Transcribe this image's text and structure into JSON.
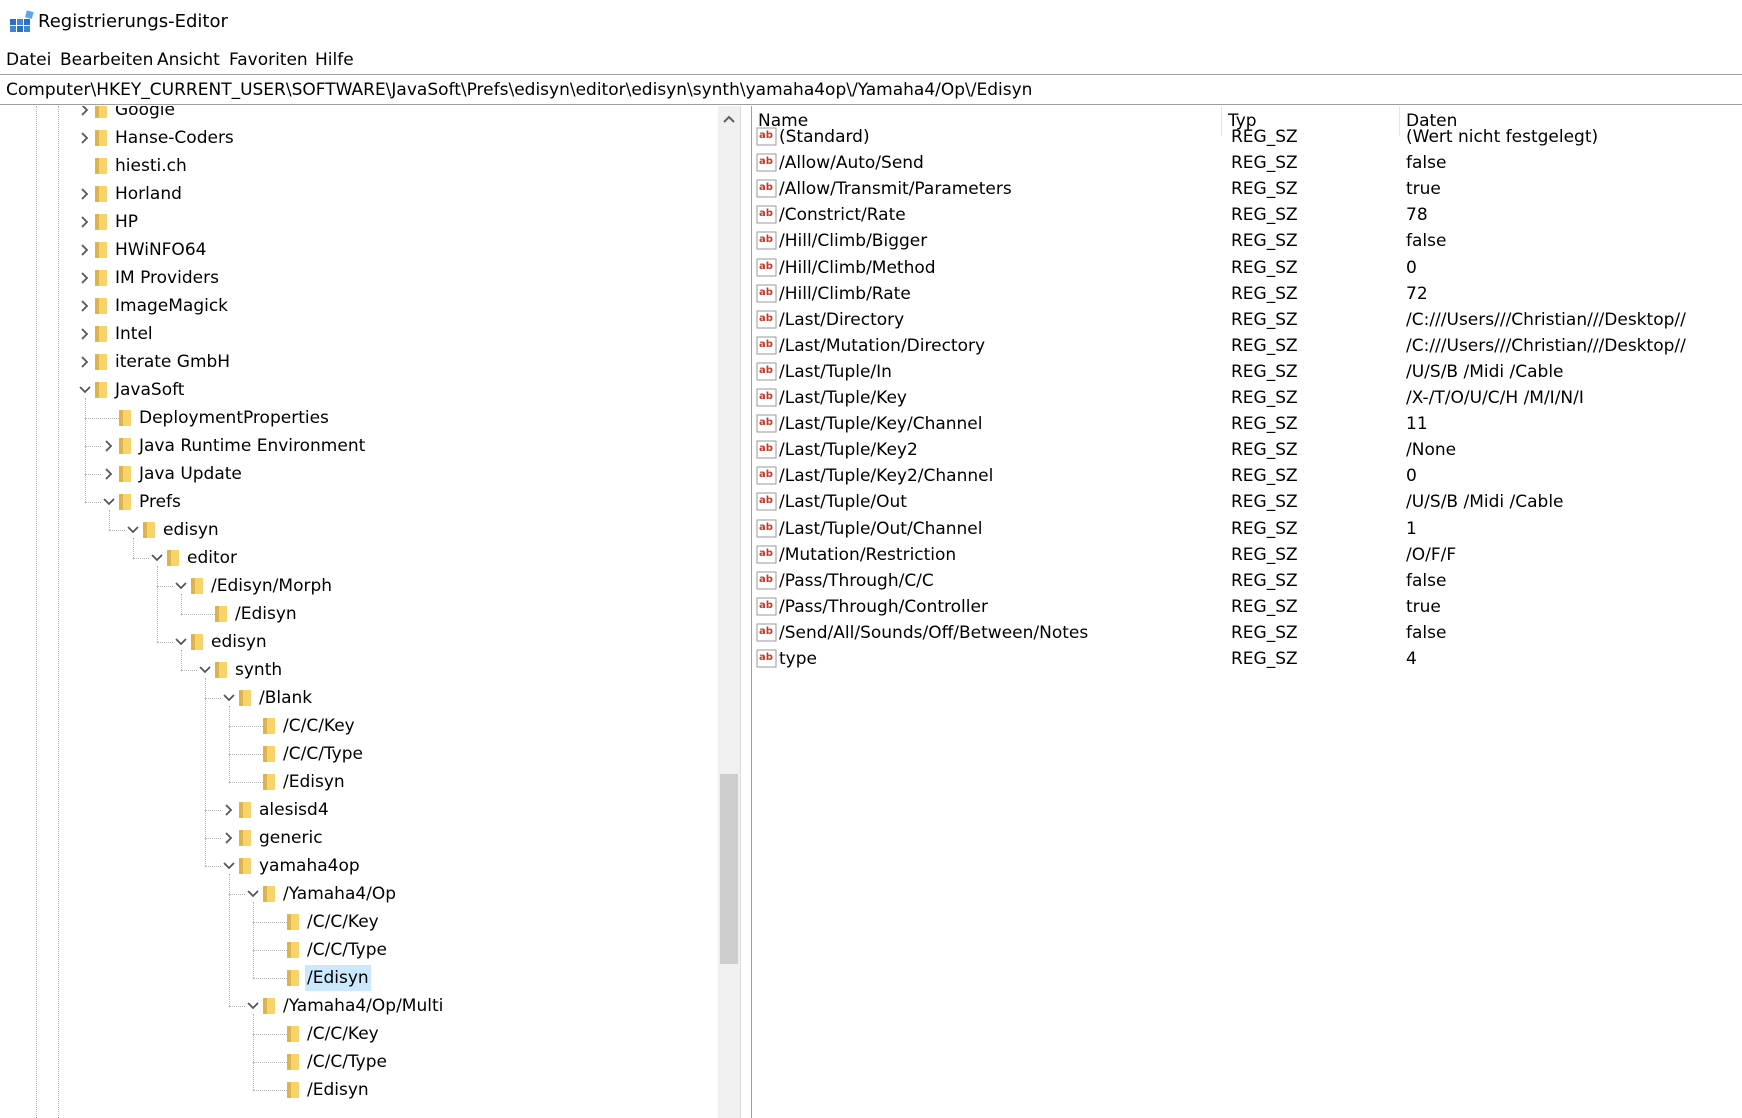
{
  "window": {
    "title": "Registrierungs-Editor",
    "icon": "registry-editor-icon"
  },
  "menu": [
    "Datei",
    "Bearbeiten",
    "Ansicht",
    "Favoriten",
    "Hilfe"
  ],
  "address": "Computer\\HKEY_CURRENT_USER\\SOFTWARE\\JavaSoft\\Prefs\\edisyn\\editor\\edisyn\\synth\\yamaha4op\\/Yamaha4/Op\\/Edisyn",
  "tree": [
    {
      "label": "Google",
      "level": 0,
      "state": "collapsed"
    },
    {
      "label": "Hanse-Coders",
      "level": 0,
      "state": "collapsed"
    },
    {
      "label": "hiesti.ch",
      "level": 0,
      "state": "leaf"
    },
    {
      "label": "Horland",
      "level": 0,
      "state": "collapsed"
    },
    {
      "label": "HP",
      "level": 0,
      "state": "collapsed"
    },
    {
      "label": "HWiNFO64",
      "level": 0,
      "state": "collapsed"
    },
    {
      "label": "IM Providers",
      "level": 0,
      "state": "collapsed"
    },
    {
      "label": "ImageMagick",
      "level": 0,
      "state": "collapsed"
    },
    {
      "label": "Intel",
      "level": 0,
      "state": "collapsed"
    },
    {
      "label": "iterate GmbH",
      "level": 0,
      "state": "collapsed"
    },
    {
      "label": "JavaSoft",
      "level": 0,
      "state": "expanded"
    },
    {
      "label": "DeploymentProperties",
      "level": 1,
      "state": "leaf"
    },
    {
      "label": "Java Runtime Environment",
      "level": 1,
      "state": "collapsed"
    },
    {
      "label": "Java Update",
      "level": 1,
      "state": "collapsed"
    },
    {
      "label": "Prefs",
      "level": 1,
      "state": "expanded"
    },
    {
      "label": "edisyn",
      "level": 2,
      "state": "expanded"
    },
    {
      "label": "editor",
      "level": 3,
      "state": "expanded"
    },
    {
      "label": "/Edisyn/Morph",
      "level": 4,
      "state": "expanded"
    },
    {
      "label": "/Edisyn",
      "level": 5,
      "state": "leaf"
    },
    {
      "label": "edisyn",
      "level": 4,
      "state": "expanded"
    },
    {
      "label": "synth",
      "level": 5,
      "state": "expanded"
    },
    {
      "label": "/Blank",
      "level": 6,
      "state": "expanded"
    },
    {
      "label": "/C/C/Key",
      "level": 7,
      "state": "leaf"
    },
    {
      "label": "/C/C/Type",
      "level": 7,
      "state": "leaf"
    },
    {
      "label": "/Edisyn",
      "level": 7,
      "state": "leaf"
    },
    {
      "label": "alesisd4",
      "level": 6,
      "state": "collapsed"
    },
    {
      "label": "generic",
      "level": 6,
      "state": "collapsed"
    },
    {
      "label": "yamaha4op",
      "level": 6,
      "state": "expanded"
    },
    {
      "label": "/Yamaha4/Op",
      "level": 7,
      "state": "expanded"
    },
    {
      "label": "/C/C/Key",
      "level": 8,
      "state": "leaf"
    },
    {
      "label": "/C/C/Type",
      "level": 8,
      "state": "leaf"
    },
    {
      "label": "/Edisyn",
      "level": 8,
      "state": "leaf",
      "selected": true
    },
    {
      "label": "/Yamaha4/Op/Multi",
      "level": 7,
      "state": "expanded"
    },
    {
      "label": "/C/C/Key",
      "level": 8,
      "state": "leaf"
    },
    {
      "label": "/C/C/Type",
      "level": 8,
      "state": "leaf"
    },
    {
      "label": "/Edisyn",
      "level": 8,
      "state": "leaf"
    }
  ],
  "columns": {
    "name": "Name",
    "type": "Typ",
    "data": "Daten"
  },
  "values": [
    {
      "name": "(Standard)",
      "type": "REG_SZ",
      "data": "(Wert nicht festgelegt)"
    },
    {
      "name": "/Allow/Auto/Send",
      "type": "REG_SZ",
      "data": "false"
    },
    {
      "name": "/Allow/Transmit/Parameters",
      "type": "REG_SZ",
      "data": "true"
    },
    {
      "name": "/Constrict/Rate",
      "type": "REG_SZ",
      "data": "78"
    },
    {
      "name": "/Hill/Climb/Bigger",
      "type": "REG_SZ",
      "data": "false"
    },
    {
      "name": "/Hill/Climb/Method",
      "type": "REG_SZ",
      "data": "0"
    },
    {
      "name": "/Hill/Climb/Rate",
      "type": "REG_SZ",
      "data": "72"
    },
    {
      "name": "/Last/Directory",
      "type": "REG_SZ",
      "data": "/C:///Users///Christian///Desktop//"
    },
    {
      "name": "/Last/Mutation/Directory",
      "type": "REG_SZ",
      "data": "/C:///Users///Christian///Desktop//"
    },
    {
      "name": "/Last/Tuple/In",
      "type": "REG_SZ",
      "data": "/U/S/B /Midi /Cable"
    },
    {
      "name": "/Last/Tuple/Key",
      "type": "REG_SZ",
      "data": "/X-/T/O/U/C/H /M/I/N/I"
    },
    {
      "name": "/Last/Tuple/Key/Channel",
      "type": "REG_SZ",
      "data": "11"
    },
    {
      "name": "/Last/Tuple/Key2",
      "type": "REG_SZ",
      "data": "/None"
    },
    {
      "name": "/Last/Tuple/Key2/Channel",
      "type": "REG_SZ",
      "data": "0"
    },
    {
      "name": "/Last/Tuple/Out",
      "type": "REG_SZ",
      "data": "/U/S/B /Midi /Cable"
    },
    {
      "name": "/Last/Tuple/Out/Channel",
      "type": "REG_SZ",
      "data": "1"
    },
    {
      "name": "/Mutation/Restriction",
      "type": "REG_SZ",
      "data": "/O/F/F"
    },
    {
      "name": "/Pass/Through/C/C",
      "type": "REG_SZ",
      "data": "false"
    },
    {
      "name": "/Pass/Through/Controller",
      "type": "REG_SZ",
      "data": "true"
    },
    {
      "name": "/Send/All/Sounds/Off/Between/Notes",
      "type": "REG_SZ",
      "data": "false"
    },
    {
      "name": "type",
      "type": "REG_SZ",
      "data": "4"
    }
  ],
  "colors": {
    "folder": "#f6d36b",
    "folder_dark": "#e0b34a",
    "selection": "#cce8ff",
    "string_icon": "#c0392b"
  }
}
